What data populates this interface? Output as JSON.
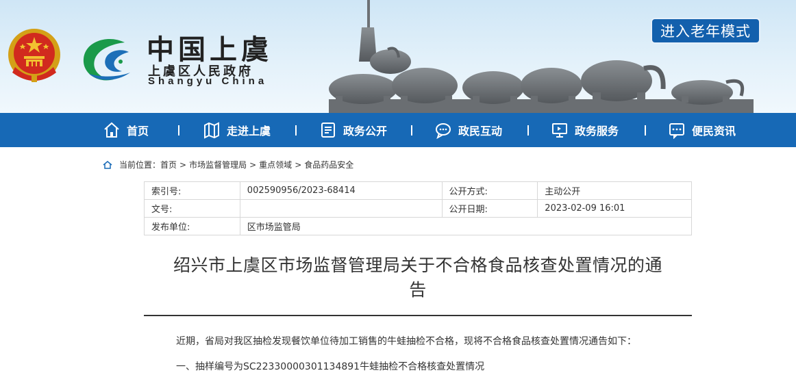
{
  "header": {
    "brand_cn": "中国上虞",
    "brand_sub": "上虞区人民政府",
    "brand_en": "Shangyu China",
    "elder_mode_button": "进入老年模式"
  },
  "nav": {
    "items": [
      {
        "label": "首页",
        "icon": "home-icon"
      },
      {
        "label": "走进上虞",
        "icon": "map-icon"
      },
      {
        "label": "政务公开",
        "icon": "document-list-icon"
      },
      {
        "label": "政民互动",
        "icon": "chat-bubble-icon"
      },
      {
        "label": "政务服务",
        "icon": "monitor-icon"
      },
      {
        "label": "便民资讯",
        "icon": "message-dots-icon"
      }
    ]
  },
  "breadcrumb": {
    "prefix": "当前位置：",
    "items": [
      "首页",
      "市场监督管理局",
      "重点领域",
      "食品药品安全"
    ],
    "separator": ">"
  },
  "info_table": {
    "rows": [
      {
        "k1": "索引号:",
        "v1": "002590956/2023-68414",
        "k2": "公开方式:",
        "v2": "主动公开"
      },
      {
        "k1": "文号:",
        "v1": "",
        "k2": "公开日期:",
        "v2": "2023-02-09 16:01"
      },
      {
        "k1": "发布单位:",
        "v1": "区市场监管局",
        "k2": "",
        "v2": ""
      }
    ]
  },
  "article": {
    "title_line1": "绍兴市上虞区市场监督管理局关于不合格食品核查处置情况的通",
    "title_line2": "告",
    "paragraphs": [
      "近期，省局对我区抽检发现餐饮单位待加工销售的牛蛙抽检不合格，现将不合格食品核查处置情况通告如下：",
      "一、抽样编号为SC22330000301134891牛蛙抽检不合格核查处置情况"
    ]
  },
  "colors": {
    "nav_blue": "#1769b6",
    "elder_button_blue": "#1360ad",
    "banner_sky": "#dcedf8",
    "logo_green": "#1a9a4a",
    "logo_blue": "#1c6fb8"
  }
}
